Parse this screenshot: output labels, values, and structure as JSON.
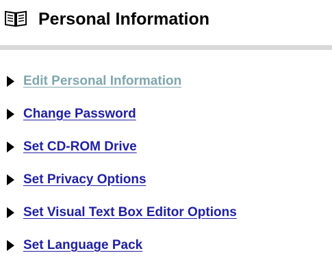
{
  "header": {
    "title": "Personal Information",
    "icon": "book-icon"
  },
  "colors": {
    "link": "#1f1fa3",
    "visited_link": "#7fa6ad",
    "divider": "#d9d9d9"
  },
  "menu": {
    "items": [
      {
        "label": "Edit Personal Information",
        "icon": "arrow-right-icon",
        "visited": true
      },
      {
        "label": "Change Password",
        "icon": "arrow-right-icon",
        "visited": false
      },
      {
        "label": "Set CD-ROM Drive",
        "icon": "arrow-right-icon",
        "visited": false
      },
      {
        "label": "Set Privacy Options",
        "icon": "arrow-right-icon",
        "visited": false
      },
      {
        "label": "Set Visual Text Box Editor Options",
        "icon": "arrow-right-icon",
        "visited": false
      },
      {
        "label": "Set Language Pack",
        "icon": "arrow-right-icon",
        "visited": false
      }
    ]
  }
}
